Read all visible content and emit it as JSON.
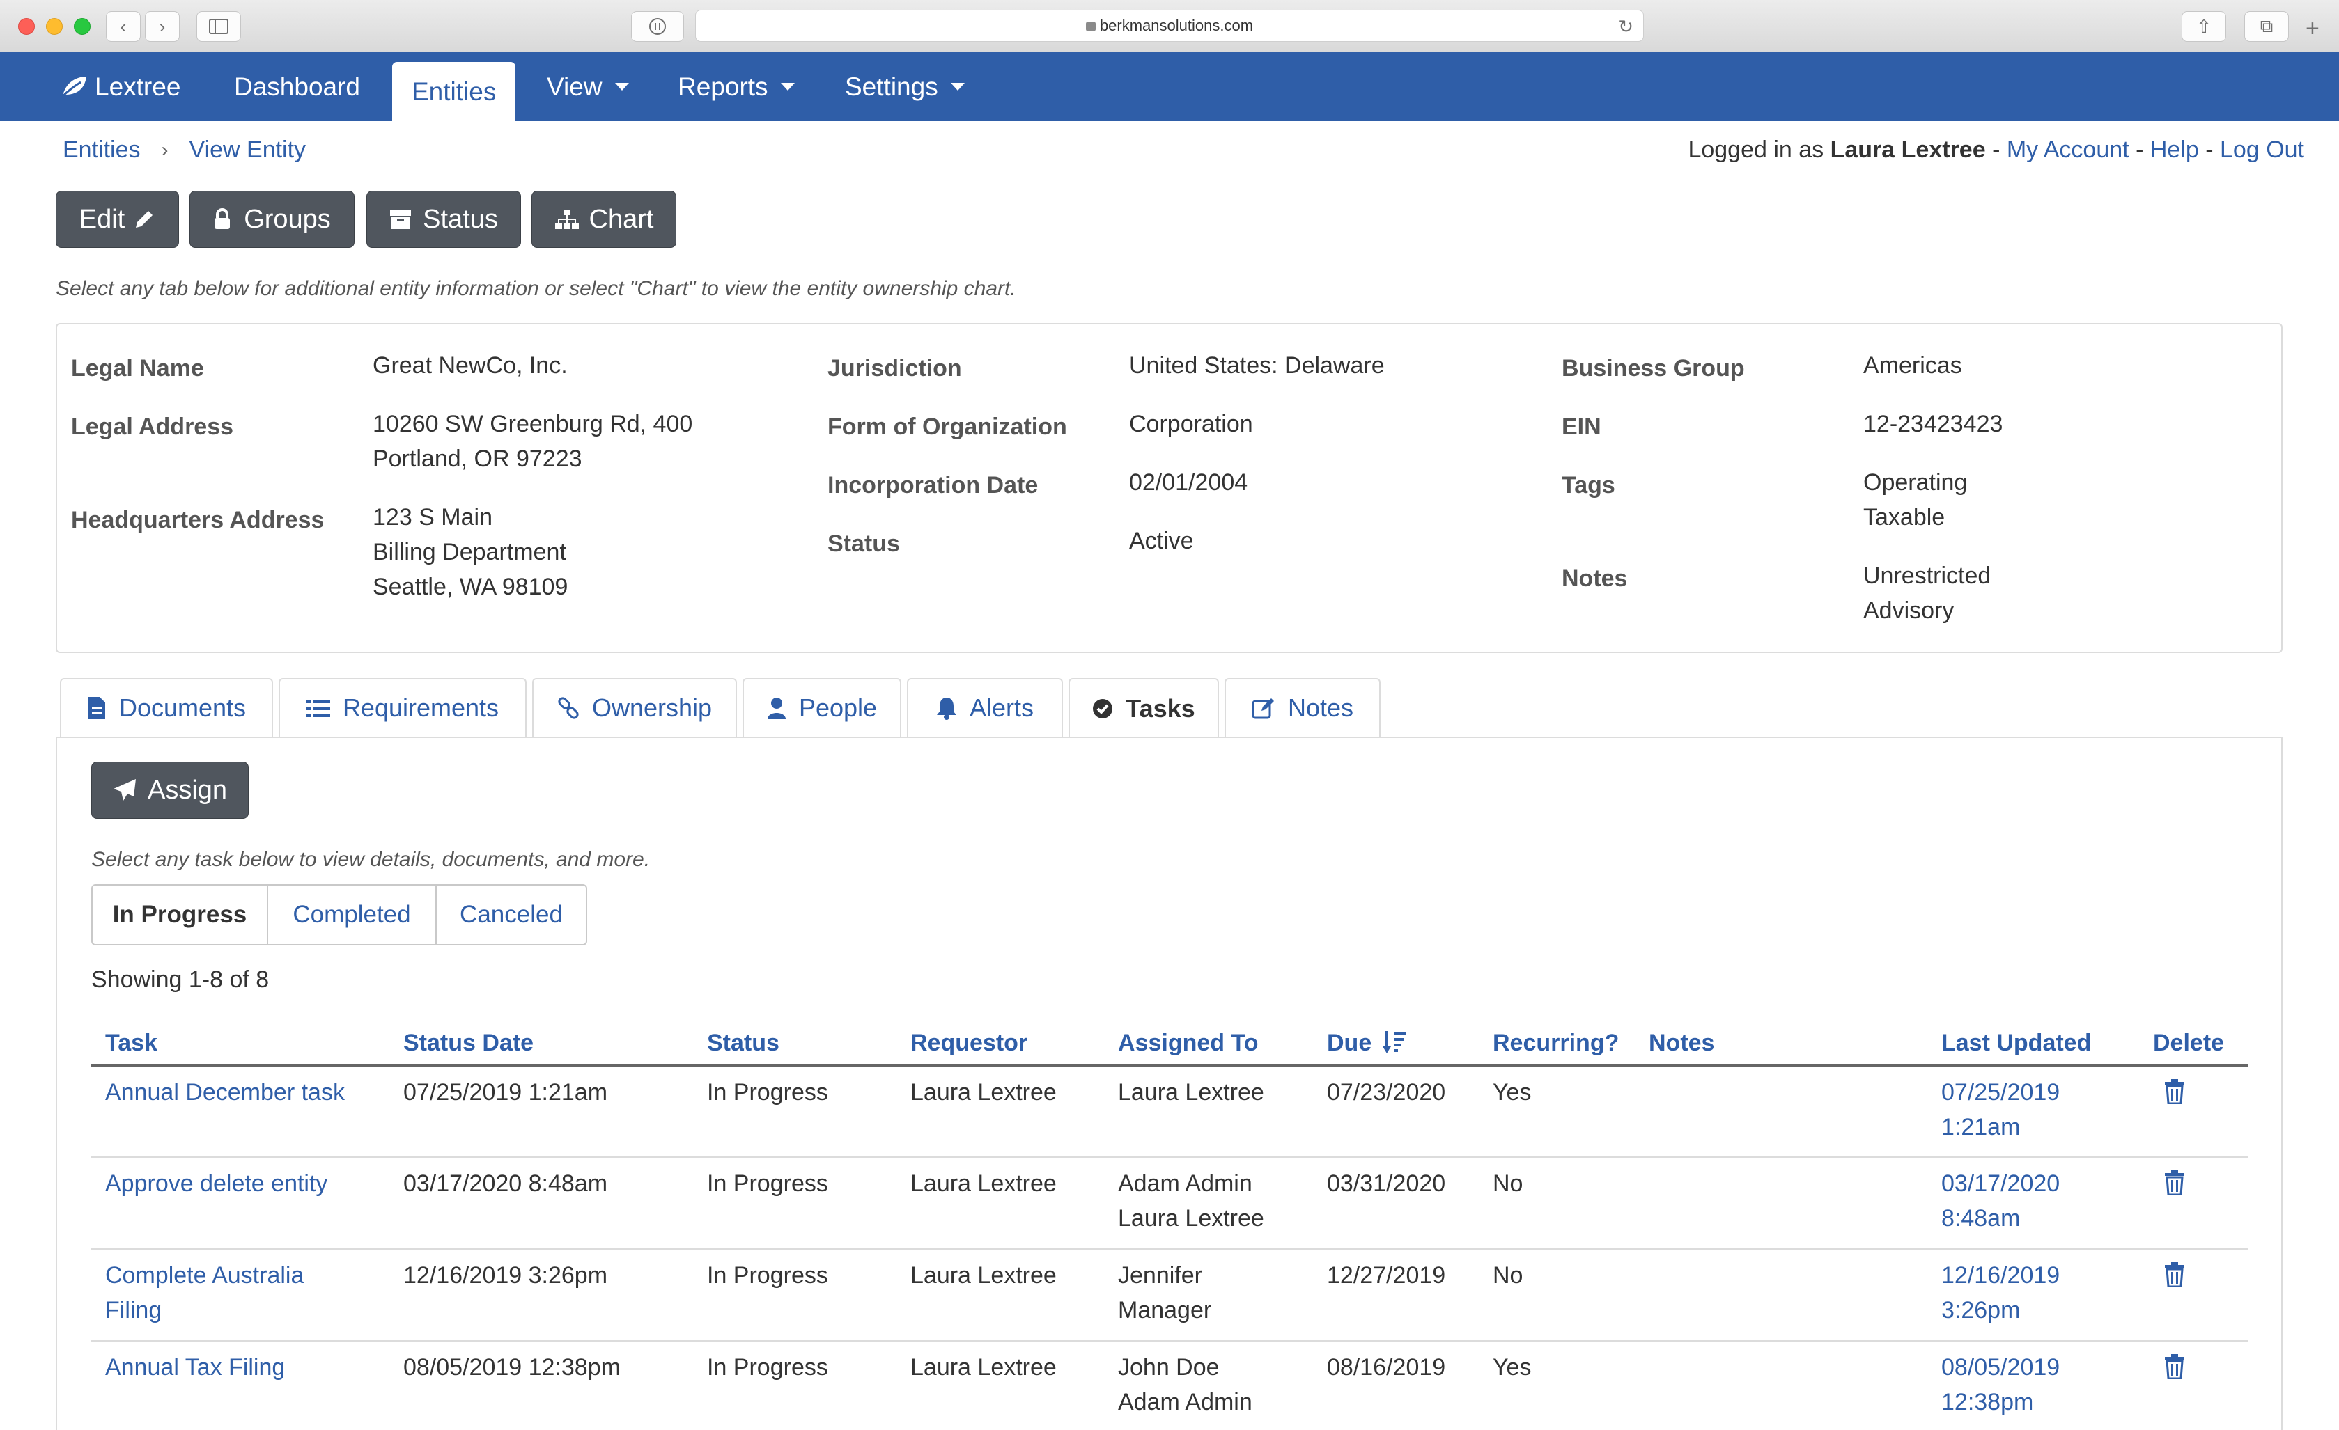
{
  "browser": {
    "url": "berkmansolutions.com"
  },
  "nav": {
    "brand": "Lextree",
    "dashboard": "Dashboard",
    "entities": "Entities",
    "view": "View",
    "reports": "Reports",
    "settings": "Settings"
  },
  "breadcrumb": {
    "entities": "Entities",
    "current": "View Entity"
  },
  "user": {
    "prefix": "Logged in as",
    "name": "Laura Lextree",
    "my_account": "My Account",
    "help": "Help",
    "logout": "Log Out"
  },
  "actions": {
    "edit": "Edit",
    "groups": "Groups",
    "status": "Status",
    "chart": "Chart"
  },
  "help_text": "Select any tab below for additional entity information or select \"Chart\" to view the entity ownership chart.",
  "entity": {
    "legal_name_label": "Legal Name",
    "legal_name": "Great NewCo, Inc.",
    "legal_address_label": "Legal Address",
    "legal_address": "10260 SW Greenburg Rd, 400\nPortland, OR 97223",
    "hq_address_label": "Headquarters Address",
    "hq_address": "123 S Main\nBilling Department\nSeattle, WA 98109",
    "jurisdiction_label": "Jurisdiction",
    "jurisdiction": "United States: Delaware",
    "form_label": "Form of Organization",
    "form": "Corporation",
    "inc_date_label": "Incorporation Date",
    "inc_date": "02/01/2004",
    "status_label": "Status",
    "status": "Active",
    "business_group_label": "Business Group",
    "business_group": "Americas",
    "ein_label": "EIN",
    "ein": "12-23423423",
    "tags_label": "Tags",
    "tags": "Operating\nTaxable",
    "notes_label": "Notes",
    "notes": "Unrestricted\nAdvisory"
  },
  "tabs": {
    "documents": "Documents",
    "requirements": "Requirements",
    "ownership": "Ownership",
    "people": "People",
    "alerts": "Alerts",
    "tasks": "Tasks",
    "notes": "Notes"
  },
  "tasks": {
    "assign": "Assign",
    "help": "Select any task below to view details, documents, and more.",
    "filter_in_progress": "In Progress",
    "filter_completed": "Completed",
    "filter_canceled": "Canceled",
    "showing": "Showing 1-8 of 8",
    "columns": {
      "task": "Task",
      "status_date": "Status Date",
      "status": "Status",
      "requestor": "Requestor",
      "assigned_to": "Assigned To",
      "due": "Due",
      "recurring": "Recurring?",
      "notes": "Notes",
      "last_updated": "Last Updated",
      "delete": "Delete"
    },
    "rows": [
      {
        "task": "Annual December task",
        "status_date": "07/25/2019 1:21am",
        "status": "In Progress",
        "requestor": "Laura Lextree",
        "assigned_to": "Laura Lextree",
        "due": "07/23/2020",
        "recurring": "Yes",
        "notes": "",
        "last_updated": "07/25/2019\n1:21am"
      },
      {
        "task": "Approve delete entity",
        "status_date": "03/17/2020 8:48am",
        "status": "In Progress",
        "requestor": "Laura Lextree",
        "assigned_to": "Adam Admin\nLaura Lextree",
        "due": "03/31/2020",
        "recurring": "No",
        "notes": "",
        "last_updated": "03/17/2020\n8:48am"
      },
      {
        "task": "Complete Australia\nFiling",
        "status_date": "12/16/2019 3:26pm",
        "status": "In Progress",
        "requestor": "Laura Lextree",
        "assigned_to": "Jennifer\nManager",
        "due": "12/27/2019",
        "recurring": "No",
        "notes": "",
        "last_updated": "12/16/2019\n3:26pm"
      },
      {
        "task": "Annual Tax Filing",
        "status_date": "08/05/2019 12:38pm",
        "status": "In Progress",
        "requestor": "Laura Lextree",
        "assigned_to": "John Doe\nAdam Admin",
        "due": "08/16/2019",
        "recurring": "Yes",
        "notes": "",
        "last_updated": "08/05/2019\n12:38pm"
      }
    ]
  }
}
